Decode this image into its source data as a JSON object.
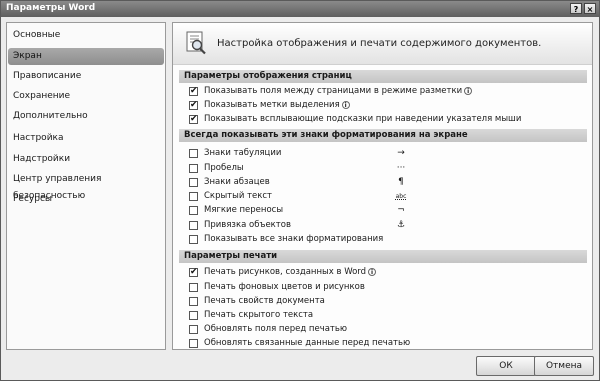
{
  "window": {
    "title": "Параметры Word",
    "help_glyph": "?",
    "close_glyph": "×"
  },
  "sidebar": {
    "items": [
      {
        "label": "Основные",
        "active": false
      },
      {
        "label": "Экран",
        "active": true
      },
      {
        "label": "Правописание",
        "active": false
      },
      {
        "label": "Сохранение",
        "active": false
      },
      {
        "label": "Дополнительно",
        "active": false
      },
      {
        "label": "Настройка",
        "active": false
      },
      {
        "label": "Надстройки",
        "active": false
      },
      {
        "label": "Центр управления безопасностью",
        "active": false
      },
      {
        "label": "Ресурсы",
        "active": false
      }
    ]
  },
  "header": {
    "text": "Настройка отображения и печати содержимого документов."
  },
  "sections": {
    "display": {
      "title": "Параметры отображения страниц",
      "options": [
        {
          "label": "Показывать поля между страницами в режиме разметки",
          "checked": true,
          "info": true
        },
        {
          "label": "Показывать метки выделения",
          "checked": true,
          "info": true
        },
        {
          "label": "Показывать всплывающие подсказки при наведении указателя мыши",
          "checked": true,
          "info": false
        }
      ]
    },
    "marks": {
      "title": "Всегда показывать эти знаки форматирования на экране",
      "options": [
        {
          "label": "Знаки табуляции",
          "checked": false,
          "symbol": "→"
        },
        {
          "label": "Пробелы",
          "checked": false,
          "symbol": "···"
        },
        {
          "label": "Знаки абзацев",
          "checked": false,
          "symbol": "¶"
        },
        {
          "label": "Скрытый текст",
          "checked": false,
          "symbol": "abc"
        },
        {
          "label": "Мягкие переносы",
          "checked": false,
          "symbol": "¬"
        },
        {
          "label": "Привязка объектов",
          "checked": false,
          "symbol": "⚓"
        },
        {
          "label": "Показывать все знаки форматирования",
          "checked": false,
          "symbol": ""
        }
      ]
    },
    "print": {
      "title": "Параметры печати",
      "options": [
        {
          "label": "Печать рисунков, созданных в Word",
          "checked": true,
          "info": true
        },
        {
          "label": "Печать фоновых цветов и рисунков",
          "checked": false,
          "info": false
        },
        {
          "label": "Печать свойств документа",
          "checked": false,
          "info": false
        },
        {
          "label": "Печать скрытого текста",
          "checked": false,
          "info": false
        },
        {
          "label": "Обновлять поля перед печатью",
          "checked": false,
          "info": false
        },
        {
          "label": "Обновлять связанные данные перед печатью",
          "checked": false,
          "info": false
        }
      ]
    }
  },
  "buttons": {
    "ok": "ОК",
    "cancel": "Отмена"
  },
  "checkmark": "✔",
  "info_glyph": "i"
}
